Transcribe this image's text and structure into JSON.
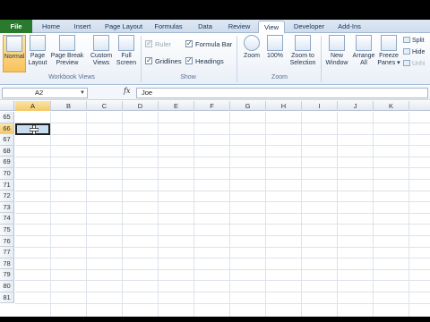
{
  "tabs": [
    {
      "label": "File"
    },
    {
      "label": "Home"
    },
    {
      "label": "Insert"
    },
    {
      "label": "Page Layout"
    },
    {
      "label": "Formulas"
    },
    {
      "label": "Data"
    },
    {
      "label": "Review"
    },
    {
      "label": "View"
    },
    {
      "label": "Developer"
    },
    {
      "label": "Add-Ins"
    }
  ],
  "ribbon": {
    "workbook_views": {
      "label": "Workbook Views",
      "normal": "Normal",
      "page_layout_1": "Page",
      "page_layout_2": "Layout",
      "page_break_1": "Page Break",
      "page_break_2": "Preview",
      "custom_views_1": "Custom",
      "custom_views_2": "Views",
      "full_screen_1": "Full",
      "full_screen_2": "Screen"
    },
    "show": {
      "label": "Show",
      "ruler": "Ruler",
      "formula_bar": "Formula Bar",
      "gridlines": "Gridlines",
      "headings": "Headings"
    },
    "zoom": {
      "label": "Zoom",
      "zoom": "Zoom",
      "zoom100": "100%",
      "zoom_sel_1": "Zoom to",
      "zoom_sel_2": "Selection"
    },
    "window": {
      "new_window_1": "New",
      "new_window_2": "Window",
      "arrange_1": "Arrange",
      "arrange_2": "All",
      "freeze_1": "Freeze",
      "freeze_2": "Panes ▾",
      "split": "Split",
      "hide": "Hide",
      "unhide": "Unhi"
    }
  },
  "formula_bar": {
    "name_box": "A2",
    "fx": "fx",
    "value": "Joe"
  },
  "columns": [
    "A",
    "B",
    "C",
    "D",
    "E",
    "F",
    "G",
    "H",
    "I",
    "J",
    "K"
  ],
  "rows": [
    "65",
    "66",
    "67",
    "68",
    "69",
    "70",
    "71",
    "72",
    "73",
    "74",
    "75",
    "76",
    "77",
    "78",
    "79",
    "80",
    "81"
  ],
  "colors": {
    "file_tab": "#2a7a2e",
    "selection_fill": "#c7ddf2",
    "header_highlight": "#f5c96a"
  }
}
